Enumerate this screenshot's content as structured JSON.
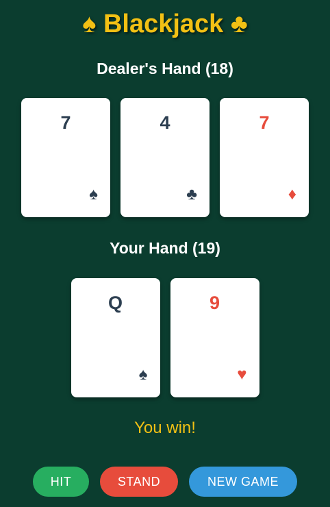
{
  "title": {
    "left_icon": "♠",
    "text": "Blackjack",
    "right_icon": "♣",
    "left_icon_name": "spade-icon",
    "right_icon_name": "club-icon",
    "color": "#f2c014"
  },
  "dealer": {
    "label": "Dealer's Hand (18)",
    "cards": [
      {
        "rank": "7",
        "suit": "♠",
        "suit_name": "spades",
        "color": "black"
      },
      {
        "rank": "4",
        "suit": "♣",
        "suit_name": "clubs",
        "color": "black"
      },
      {
        "rank": "7",
        "suit": "♦",
        "suit_name": "diamonds",
        "color": "red"
      }
    ]
  },
  "player": {
    "label": "Your Hand (19)",
    "cards": [
      {
        "rank": "Q",
        "suit": "♠",
        "suit_name": "spades",
        "color": "black"
      },
      {
        "rank": "9",
        "suit": "♥",
        "suit_name": "hearts",
        "color": "red"
      }
    ]
  },
  "message": "You win!",
  "controls": {
    "hit_label": "HIT",
    "stand_label": "STAND",
    "new_game_label": "NEW GAME"
  },
  "colors": {
    "table": "#0b3d2f",
    "accent": "#f2c014",
    "card_black": "#2c3e50",
    "card_red": "#e74c3c",
    "hit": "#27ae60",
    "stand": "#e74c3c",
    "new_game": "#3498db"
  }
}
